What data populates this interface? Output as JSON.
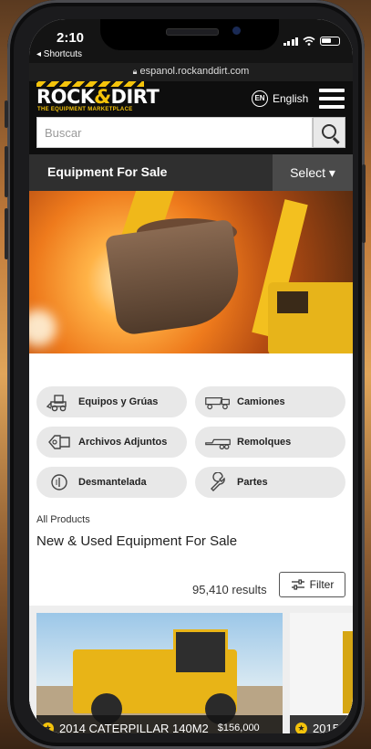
{
  "status": {
    "time": "2:10",
    "back_app": "◂ Shortcuts"
  },
  "browser": {
    "url": "espanol.rockanddirt.com"
  },
  "header": {
    "logo_word_1": "ROCK",
    "logo_amp": "&",
    "logo_word_2": "DIRT",
    "logo_tagline": "THE EQUIPMENT MARKETPLACE",
    "lang_code": "EN",
    "lang_label": "English"
  },
  "search": {
    "placeholder": "Buscar"
  },
  "section": {
    "title": "Equipment For Sale",
    "select_label": "Select ▾"
  },
  "categories": [
    {
      "label": "Equipos y Grúas",
      "icon": "loader-icon"
    },
    {
      "label": "Camiones",
      "icon": "truck-icon"
    },
    {
      "label": "Archivos Adjuntos",
      "icon": "attachment-icon"
    },
    {
      "label": "Remolques",
      "icon": "trailer-icon"
    },
    {
      "label": "Desmantelada",
      "icon": "dismantled-icon"
    },
    {
      "label": "Partes",
      "icon": "wrench-icon"
    }
  ],
  "breadcrumb": "All Products",
  "page_title": "New & Used Equipment For Sale",
  "results": {
    "count_text": "95,410 results",
    "filter_label": "Filter"
  },
  "listings": [
    {
      "title": "2014 CATERPILLAR 140M2",
      "price": "$156,000"
    },
    {
      "title": "2015",
      "price": ""
    }
  ],
  "colors": {
    "brand_yellow": "#f4c30b",
    "header_bg": "#0e0e0e",
    "section_bg": "#2f2f2f",
    "pill_bg": "#e8e8e8"
  }
}
